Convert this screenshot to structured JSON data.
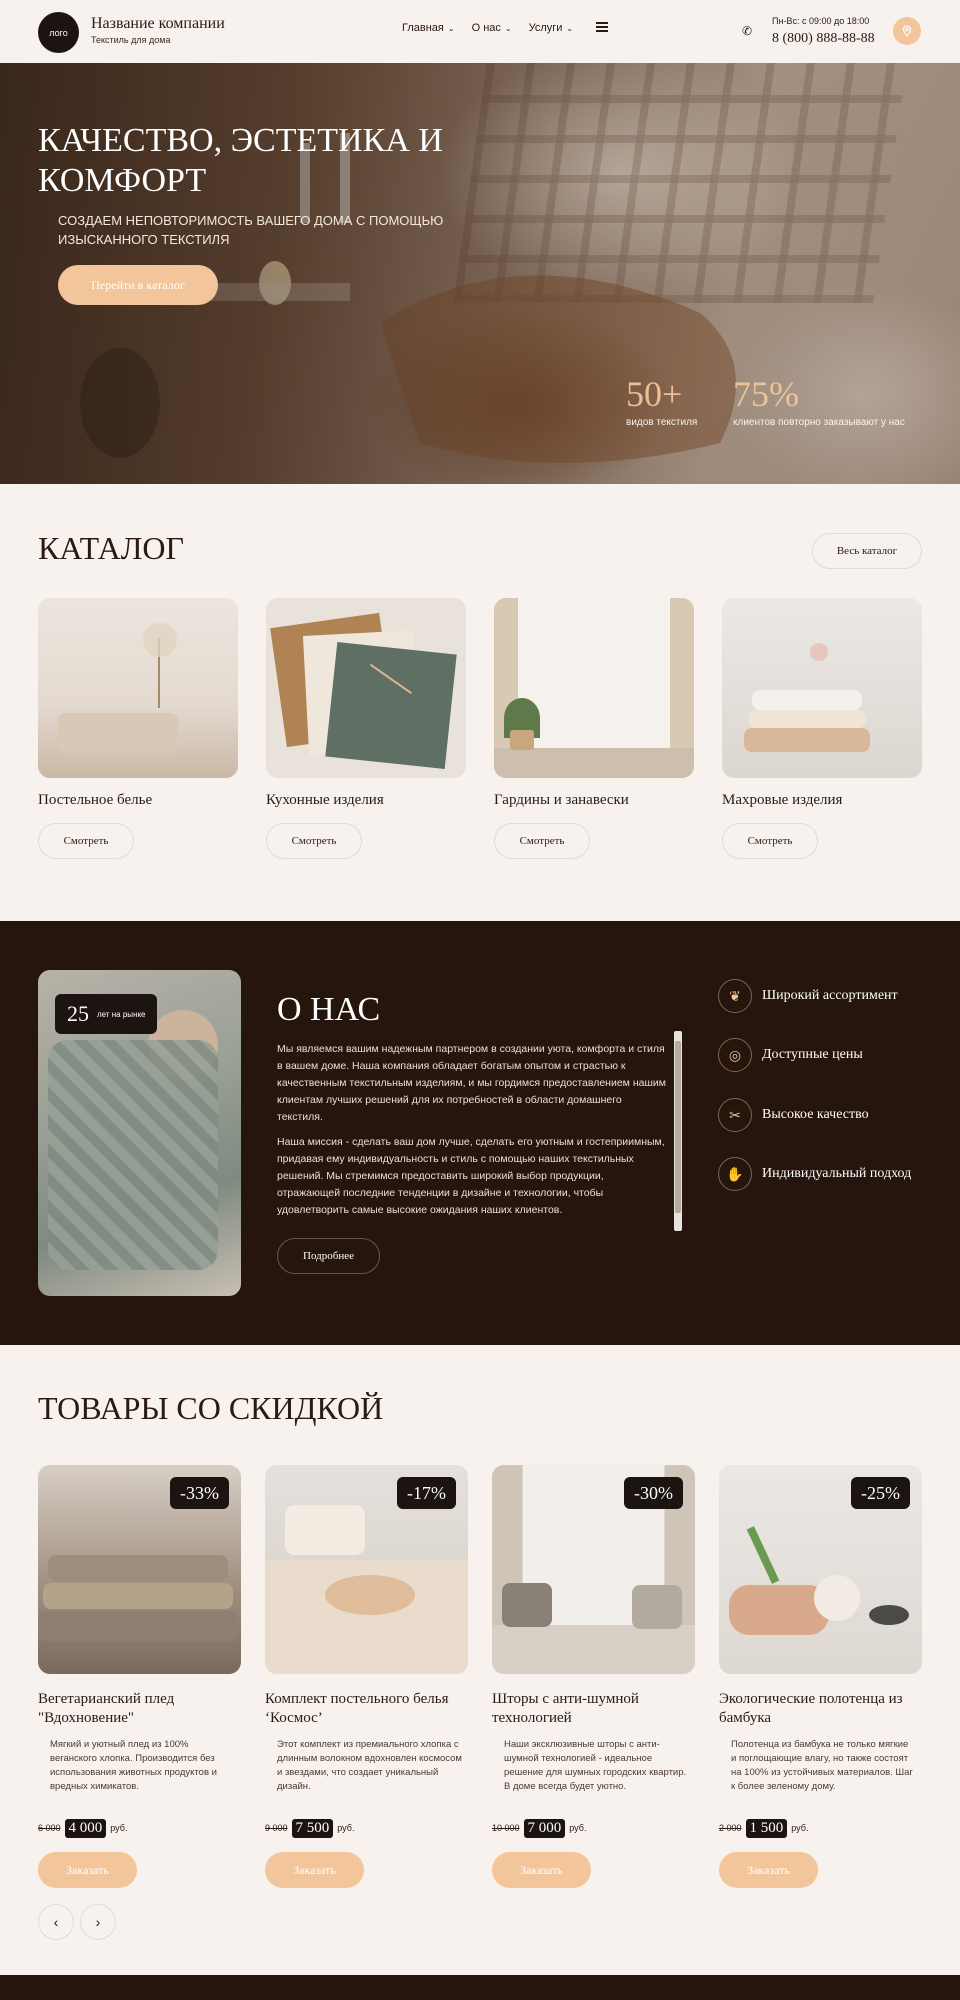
{
  "header": {
    "logo": "лого",
    "company_name": "Название компании",
    "company_sub": "Текстиль для дома",
    "nav": [
      {
        "label": "Главная"
      },
      {
        "label": "О нас"
      },
      {
        "label": "Услуги"
      }
    ],
    "hours": "Пн-Вс: с 09:00 до 18:00",
    "phone": "8 (800) 888-88-88"
  },
  "hero": {
    "title": "Качество, эстетика и комфорт",
    "subtitle": "Создаем неповторимость вашего дома с помощью изысканного текстиля",
    "button": "Перейти в каталог",
    "stats": [
      {
        "value": "50+",
        "label": "видов текстиля"
      },
      {
        "value": "75%",
        "label": "клиентов повторно заказывают у нас"
      }
    ]
  },
  "catalog": {
    "title": "КАТАЛОГ",
    "all_button": "Весь каталог",
    "items": [
      {
        "name": "Постельное белье",
        "button": "Смотреть"
      },
      {
        "name": "Кухонные изделия",
        "button": "Смотреть"
      },
      {
        "name": "Гардины и занавески",
        "button": "Смотреть"
      },
      {
        "name": "Махровые изделия",
        "button": "Смотреть"
      }
    ]
  },
  "about": {
    "badge_number": "25",
    "badge_text": "лет на рынке",
    "title": "О НАС",
    "paragraphs": [
      "Мы являемся вашим надежным партнером в создании уюта, комфорта и стиля в вашем доме. Наша компания обладает богатым опытом и страстью к качественным текстильным изделиям, и мы гордимся предоставлением нашим клиентам лучших решений для их потребностей в области домашнего текстиля.",
      "Наша миссия - сделать ваш дом лучше, сделать его уютным и гостеприимным, придавая ему индивидуальность и стиль с помощью наших текстильных решений. Мы стремимся предоставить широкий выбор продукции, отражающей последние тенденции в дизайне и технологии, чтобы удовлетворить самые высокие ожидания наших клиентов."
    ],
    "more_button": "Подробнее",
    "features": [
      {
        "label": "Широкий ассортимент",
        "icon": "fabric-icon"
      },
      {
        "label": "Доступные цены",
        "icon": "coins-icon"
      },
      {
        "label": "Высокое качество",
        "icon": "sewing-icon"
      },
      {
        "label": "Индивидуальный подход",
        "icon": "handshake-icon"
      }
    ]
  },
  "discounts": {
    "title": "ТОВАРЫ СО СКИДКОЙ",
    "currency": "руб.",
    "order_button": "Заказать",
    "products": [
      {
        "discount": "-33%",
        "name": "Вегетарианский плед \"Вдохновение\"",
        "desc": "Мягкий и уютный плед из 100% веганского хлопка. Производится без использования животных продуктов и вредных химикатов.",
        "old_price": "6 000",
        "new_price": "4 000"
      },
      {
        "discount": "-17%",
        "name": "Комплект постельного белья ‘Космос’",
        "desc": "Этот комплект из премиального хлопка с длинным волокном вдохновлен космосом и звездами, что создает уникальный дизайн.",
        "old_price": "9 000",
        "new_price": "7 500"
      },
      {
        "discount": "-30%",
        "name": "Шторы с анти-шумной технологией",
        "desc": "Наши эксклюзивные шторы с анти-шумной технологией - идеальное решение для шумных городских квартир. В доме всегда будет уютно.",
        "old_price": "10 000",
        "new_price": "7 000"
      },
      {
        "discount": "-25%",
        "name": "Экологические полотенца из бамбука",
        "desc": "Полотенца из бамбука не только мягкие и поглощающие влагу, но также состоят на 100% из устойчивых материалов. Шаг к более зеленому дому.",
        "old_price": "2 000",
        "new_price": "1 500"
      }
    ]
  },
  "colors": {
    "accent": "#f2c59a",
    "dark": "#26150c",
    "background": "#f7f2ee"
  }
}
